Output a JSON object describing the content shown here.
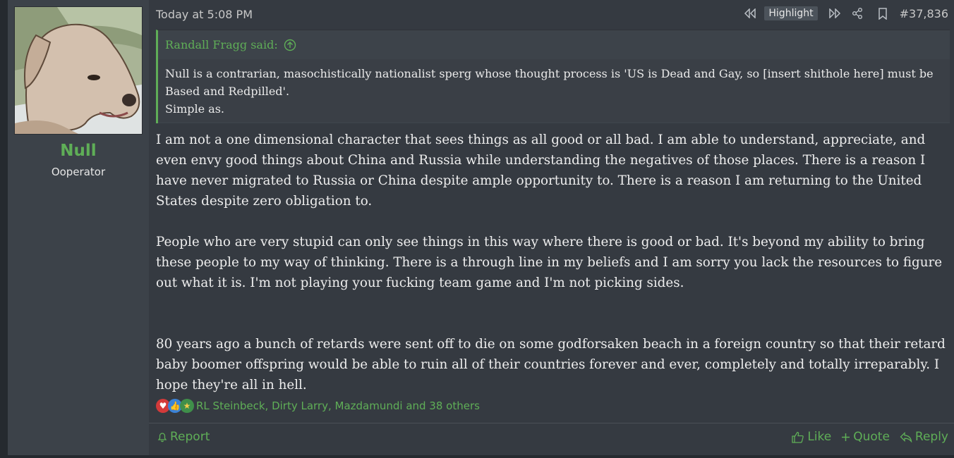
{
  "user": {
    "name": "Null",
    "title": "Ooperator"
  },
  "header": {
    "date": "Today at 5:08 PM",
    "highlight_label": "Highlight",
    "post_number": "#37,836"
  },
  "quote": {
    "author": "Randall Fragg said:",
    "line1": "Null is a contrarian, masochistically nationalist sperg whose thought process is 'US is Dead and Gay, so [insert shithole here] must be",
    "line2": "Based and Redpilled'.",
    "line3": "Simple as."
  },
  "message": {
    "paragraph1": "I am not a one dimensional character that sees things as all good or all bad. I am able to understand, appreciate, and even envy good things about China and Russia while understanding the negatives of those places. There is a reason I have never migrated to Russia or China despite ample opportunity to. There is a reason I am returning to the United States despite zero obligation to.",
    "paragraph2": "People who are very stupid can only see things in this way where there is good or bad. It's beyond my ability to bring these people to my way of thinking. There is a through line in my beliefs and I am sorry you lack the resources to figure out what it is. I'm not playing your fucking team game and I'm not picking sides.",
    "paragraph3": "80 years ago a bunch of retards were sent off to die on some godforsaken beach in a foreign country so that their retard baby boomer offspring would be able to ruin all of their countries forever and ever, completely and totally irreparably. I hope they're all in hell."
  },
  "reactions": {
    "list": "RL Steinbeck, Dirty Larry, Mazdamundi and 38 others"
  },
  "footer": {
    "report": "Report",
    "like": "Like",
    "quote": "Quote",
    "reply": "Reply"
  },
  "colors": {
    "accent": "#5fae57",
    "background": "#353a41"
  }
}
